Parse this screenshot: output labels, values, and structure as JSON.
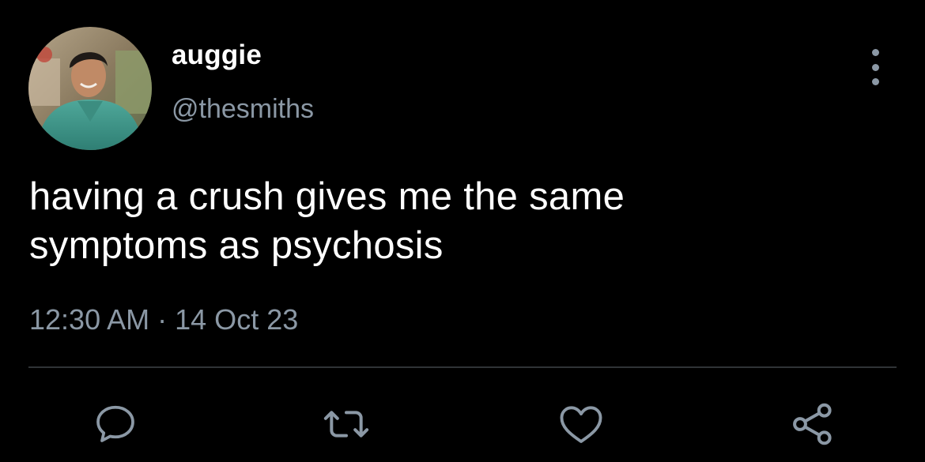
{
  "user": {
    "display_name": "auggie",
    "handle": "@thesmiths"
  },
  "tweet": {
    "text": "having a crush gives me the same\nsymptoms as psychosis",
    "time": "12:30 AM",
    "separator": "·",
    "date": "14 Oct 23"
  },
  "actions": {
    "reply_icon": "reply-bubble-icon",
    "retweet_icon": "retweet-arrows-icon",
    "like_icon": "heart-icon",
    "share_icon": "share-nodes-icon"
  },
  "colors": {
    "background": "#000000",
    "text_primary": "#ffffff",
    "text_secondary": "#8b98a5",
    "divider": "#2f3336"
  }
}
